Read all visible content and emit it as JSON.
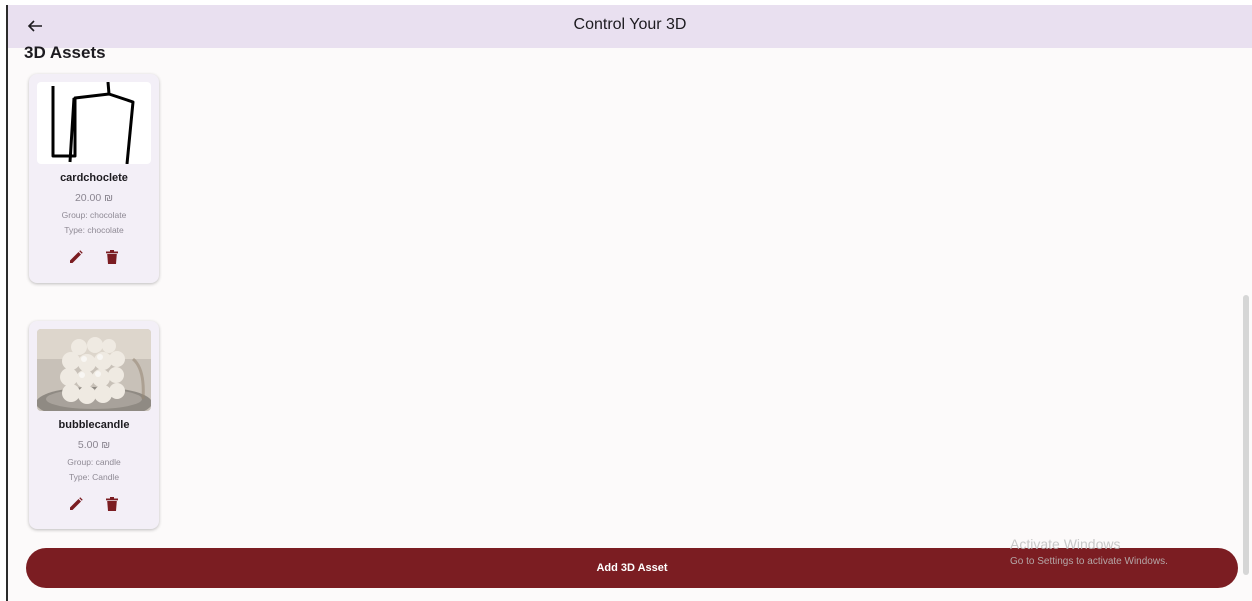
{
  "appbar": {
    "title": "Control Your 3D",
    "back_icon": "arrow-left-icon"
  },
  "section": {
    "title": "3D Assets"
  },
  "assets": [
    {
      "name": "cardchoclete",
      "price": "20.00 ₪",
      "group": "Group: chocolate",
      "type": "Type: chocolate"
    },
    {
      "name": "bubblecandle",
      "price": "5.00 ₪",
      "group": "Group: candle",
      "type": "Type: Candle"
    }
  ],
  "actions": {
    "edit_icon": "pencil-icon",
    "delete_icon": "trash-icon"
  },
  "add_button": {
    "label": "Add 3D Asset"
  },
  "watermark": {
    "title": "Activate Windows",
    "subtitle": "Go to Settings to activate Windows."
  },
  "colors": {
    "appbar_bg": "#e9e0f0",
    "accent": "#7b1d22",
    "card_bg": "#f3eff7",
    "page_bg": "#fcfafa"
  }
}
